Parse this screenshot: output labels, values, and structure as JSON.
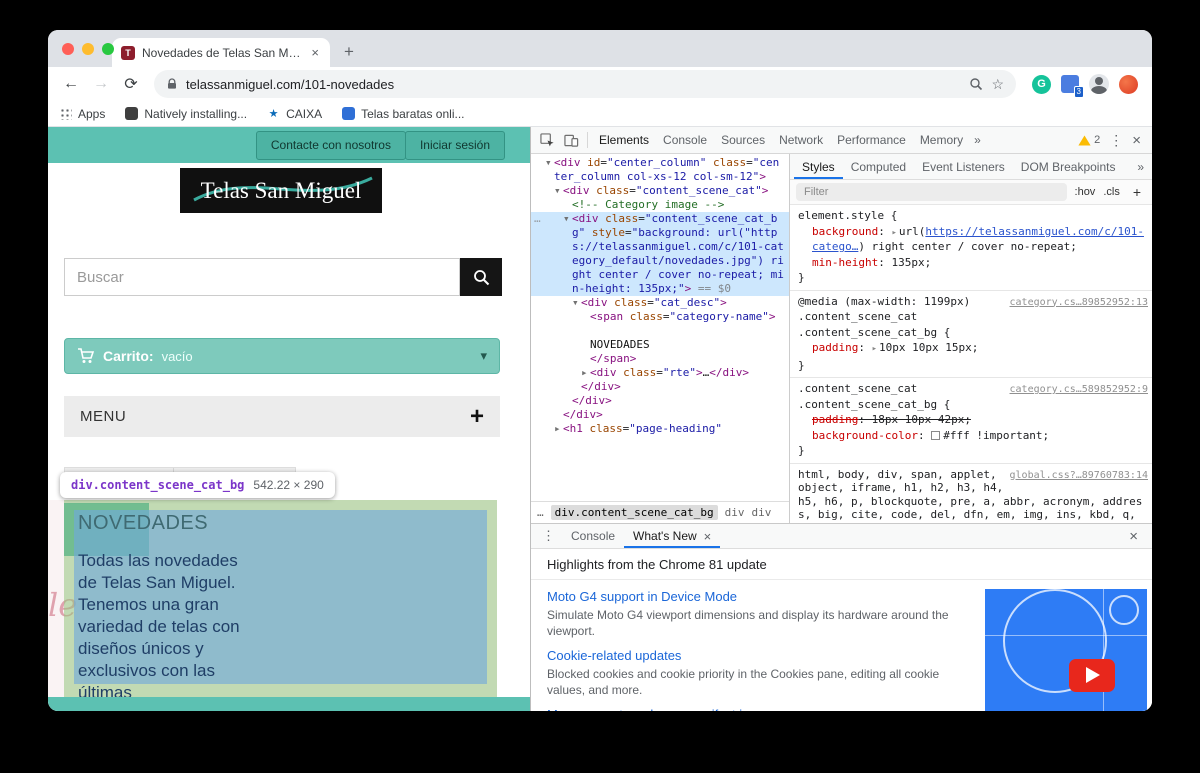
{
  "colors": {
    "site_teal": "#5cc1b2",
    "button_teal": "#4db3a3",
    "cart_teal": "#7ecabc",
    "highlight_content_blue": "#6fa8dc",
    "highlight_padding_green": "#93c47d",
    "selection_blue": "#cde7fd",
    "link_blue": "#1a66d8",
    "thumb_blue": "#2e7cf5",
    "play_red": "#e8271c",
    "warning_yellow": "#fbbc04"
  },
  "chrome": {
    "tab_title": "Novedades de Telas San Miguel",
    "tab_close": "×",
    "new_tab_icon": "+",
    "back_icon": "←",
    "forward_icon": "→",
    "reload_icon": "⟳",
    "url": "telassanmiguel.com/101-novedades",
    "star_icon": "☆",
    "ext_badge": "3",
    "apps_label": "Apps",
    "bookmarks": [
      {
        "label": "Natively installing...",
        "fav": "dark"
      },
      {
        "label": "CAIXA",
        "fav": "caixa"
      },
      {
        "label": "Telas baratas onli...",
        "fav": "blue"
      }
    ]
  },
  "site": {
    "contact_button": "Contacte con nosotros",
    "login_button": "Iniciar sesión",
    "logo_text": "Telas San Miguel",
    "search_placeholder": "Buscar",
    "cart_label": "Carrito:",
    "cart_status": "vacío",
    "cart_caret": "▾",
    "menu_label": "MENU",
    "menu_expand": "+",
    "overlay_tooltip": {
      "selector": "div.content_scene_cat_bg",
      "size": "542.22 × 290"
    },
    "category_name": "NOVEDADES",
    "category_desc": "Todas las novedades de Telas San Miguel. Tenemos una gran variedad de telas con diseños únicos y exclusivos con las últimas",
    "decor_script": "le"
  },
  "devtools": {
    "tabs": [
      "Elements",
      "Console",
      "Sources",
      "Network",
      "Performance",
      "Memory"
    ],
    "active_tab": "Elements",
    "more_tabs": "»",
    "warning_count": "2",
    "menu_icon": "⋮",
    "close_icon": "×",
    "sidebar_tabs": [
      "Styles",
      "Computed",
      "Event Listeners",
      "DOM Breakpoints"
    ],
    "sidebar_more": "»",
    "filter_placeholder": "Filter",
    "hov_label": ":hov",
    "cls_label": ".cls",
    "add_label": "+",
    "tree": [
      {
        "i": 0,
        "a": "o",
        "sel": false,
        "t": [
          [
            "tag",
            "<div"
          ],
          [
            "attr",
            " id"
          ],
          [
            "p",
            "="
          ],
          [
            "val",
            "\"center_column\""
          ],
          [
            "attr",
            " class"
          ],
          [
            "p",
            "="
          ],
          [
            "val",
            "\"center_column col-xs-12 col-sm-12\""
          ],
          [
            "tag",
            ">"
          ]
        ]
      },
      {
        "i": 1,
        "a": "o",
        "sel": false,
        "t": [
          [
            "tag",
            "<div"
          ],
          [
            "attr",
            " class"
          ],
          [
            "p",
            "="
          ],
          [
            "val",
            "\"content_scene_cat\""
          ],
          [
            "tag",
            ">"
          ]
        ]
      },
      {
        "i": 2,
        "a": null,
        "sel": false,
        "t": [
          [
            "com",
            "<!-- Category image -->"
          ]
        ]
      },
      {
        "i": 2,
        "a": "o",
        "sel": true,
        "g": "…",
        "t": [
          [
            "tag",
            "<div"
          ],
          [
            "attr",
            " class"
          ],
          [
            "p",
            "="
          ],
          [
            "val",
            "\"content_scene_cat_bg\""
          ],
          [
            "attr",
            " style"
          ],
          [
            "p",
            "="
          ],
          [
            "val",
            "\"background: url(\"https://telassanmiguel.com/c/101-category_default/novedades.jpg\") right center / cover no-repeat; min-height: 135px;\""
          ],
          [
            "tag",
            ">"
          ],
          [
            "flag",
            " == $0"
          ]
        ]
      },
      {
        "i": 3,
        "a": "o",
        "sel": false,
        "t": [
          [
            "tag",
            "<div"
          ],
          [
            "attr",
            " class"
          ],
          [
            "p",
            "="
          ],
          [
            "val",
            "\"cat_desc\""
          ],
          [
            "tag",
            ">"
          ]
        ]
      },
      {
        "i": 4,
        "a": null,
        "sel": false,
        "t": [
          [
            "tag",
            "<span"
          ],
          [
            "attr",
            " class"
          ],
          [
            "p",
            "="
          ],
          [
            "val",
            "\"category-name\""
          ],
          [
            "tag",
            ">"
          ]
        ]
      },
      {
        "i": 4,
        "a": null,
        "sel": false,
        "t": [
          [
            "txt",
            " "
          ]
        ]
      },
      {
        "i": 4,
        "a": null,
        "sel": false,
        "t": [
          [
            "txt",
            "NOVEDADES"
          ]
        ]
      },
      {
        "i": 4,
        "a": null,
        "sel": false,
        "t": [
          [
            "tag",
            "</span>"
          ]
        ]
      },
      {
        "i": 4,
        "a": "c",
        "sel": false,
        "t": [
          [
            "tag",
            "<div"
          ],
          [
            "attr",
            " class"
          ],
          [
            "p",
            "="
          ],
          [
            "val",
            "\"rte\""
          ],
          [
            "tag",
            ">"
          ],
          [
            "txt",
            "…"
          ],
          [
            "tag",
            "</div>"
          ]
        ]
      },
      {
        "i": 3,
        "a": null,
        "sel": false,
        "t": [
          [
            "tag",
            "</div>"
          ]
        ]
      },
      {
        "i": 2,
        "a": null,
        "sel": false,
        "t": [
          [
            "tag",
            "</div>"
          ]
        ]
      },
      {
        "i": 1,
        "a": null,
        "sel": false,
        "t": [
          [
            "tag",
            "</div>"
          ]
        ]
      },
      {
        "i": 1,
        "a": "c",
        "sel": false,
        "t": [
          [
            "tag",
            "<h1"
          ],
          [
            "attr",
            " class"
          ],
          [
            "p",
            "="
          ],
          [
            "val",
            "\"page-heading\""
          ]
        ]
      }
    ],
    "crumbs": [
      {
        "label": "…",
        "sel": false
      },
      {
        "label": "div.content_scene_cat_bg",
        "sel": true
      },
      {
        "label": "div",
        "sel": false
      },
      {
        "label": "div",
        "sel": false
      }
    ],
    "styles": [
      {
        "source": null,
        "rows": [
          {
            "t": [
              [
                "sel",
                "element.style"
              ],
              [
                "p",
                " {"
              ]
            ]
          },
          {
            "ind": true,
            "t": [
              [
                "prop",
                "background"
              ],
              [
                "p",
                ": "
              ],
              [
                "tri",
                "▸"
              ],
              [
                "p",
                "url("
              ],
              [
                "slink",
                "https://telassanmiguel.com/c/101-catego…"
              ],
              [
                "p",
                ") right center / cover no-repeat;"
              ]
            ]
          },
          {
            "ind": true,
            "t": [
              [
                "prop",
                "min-height"
              ],
              [
                "p",
                ": 135px;"
              ]
            ]
          },
          {
            "t": [
              [
                "p",
                "}"
              ]
            ]
          }
        ]
      },
      {
        "source": "category.cs…89852952:13",
        "rows": [
          {
            "t": [
              [
                "media",
                "@media (max-width: 1199px)"
              ]
            ]
          },
          {
            "t": [
              [
                "sel",
                ".content_scene_cat"
              ]
            ]
          },
          {
            "t": [
              [
                "sel",
                ".content_scene_cat_bg"
              ],
              [
                "p",
                " {"
              ]
            ]
          },
          {
            "ind": true,
            "t": [
              [
                "prop",
                "padding"
              ],
              [
                "p",
                ": "
              ],
              [
                "tri",
                "▸"
              ],
              [
                "p",
                "10px 10px 15px;"
              ]
            ]
          },
          {
            "t": [
              [
                "p",
                "}"
              ]
            ]
          }
        ]
      },
      {
        "source": "category.cs…589852952:9",
        "rows": [
          {
            "t": [
              [
                "sel",
                ".content_scene_cat"
              ]
            ]
          },
          {
            "t": [
              [
                "sel",
                ".content_scene_cat_bg"
              ],
              [
                "p",
                " {"
              ]
            ]
          },
          {
            "ind": true,
            "strike": true,
            "t": [
              [
                "prop",
                "padding"
              ],
              [
                "p",
                ": 18px 10px 42px;"
              ]
            ]
          },
          {
            "ind": true,
            "t": [
              [
                "prop",
                "background-color"
              ],
              [
                "p",
                ": "
              ],
              [
                "swatch",
                ""
              ],
              [
                "p",
                "#fff !important;"
              ]
            ]
          },
          {
            "t": [
              [
                "p",
                "}"
              ]
            ]
          }
        ]
      },
      {
        "source": "global.css?…89760783:14",
        "rows": [
          {
            "t": [
              [
                "sel",
                "html, body, div, span, applet, object, iframe, h1, h2, h3, h4, h5, h6, p, blockquote, pre, a, abbr, acronym, address, big, cite, code, del, dfn, em, img, ins, kbd, q, s, samp, small, strike, strong, sub, sup, tt, var, b, u, i, center, dl, dt, dd, ol, ul, li, fieldset, form, label, legend, table, caption, tbody, tfoot, thead, tr, th, td, article, aside, canvas, details, embed, figure, figcaption, footer, header, hgroup, menu, nav, output,"
              ]
            ]
          }
        ]
      }
    ],
    "drawer": {
      "tabs": [
        {
          "label": "Console",
          "active": false,
          "closable": false
        },
        {
          "label": "What's New",
          "active": true,
          "closable": true
        }
      ],
      "close_icon": "×",
      "header": "Highlights from the Chrome 81 update",
      "items": [
        {
          "title": "Moto G4 support in Device Mode",
          "desc": "Simulate Moto G4 viewport dimensions and display its hardware around the viewport."
        },
        {
          "title": "Cookie-related updates",
          "desc": "Blocked cookies and cookie priority in the Cookies pane, editing all cookie values, and more."
        },
        {
          "title": "More accurate web app manifest icons",
          "desc": ""
        }
      ]
    }
  }
}
